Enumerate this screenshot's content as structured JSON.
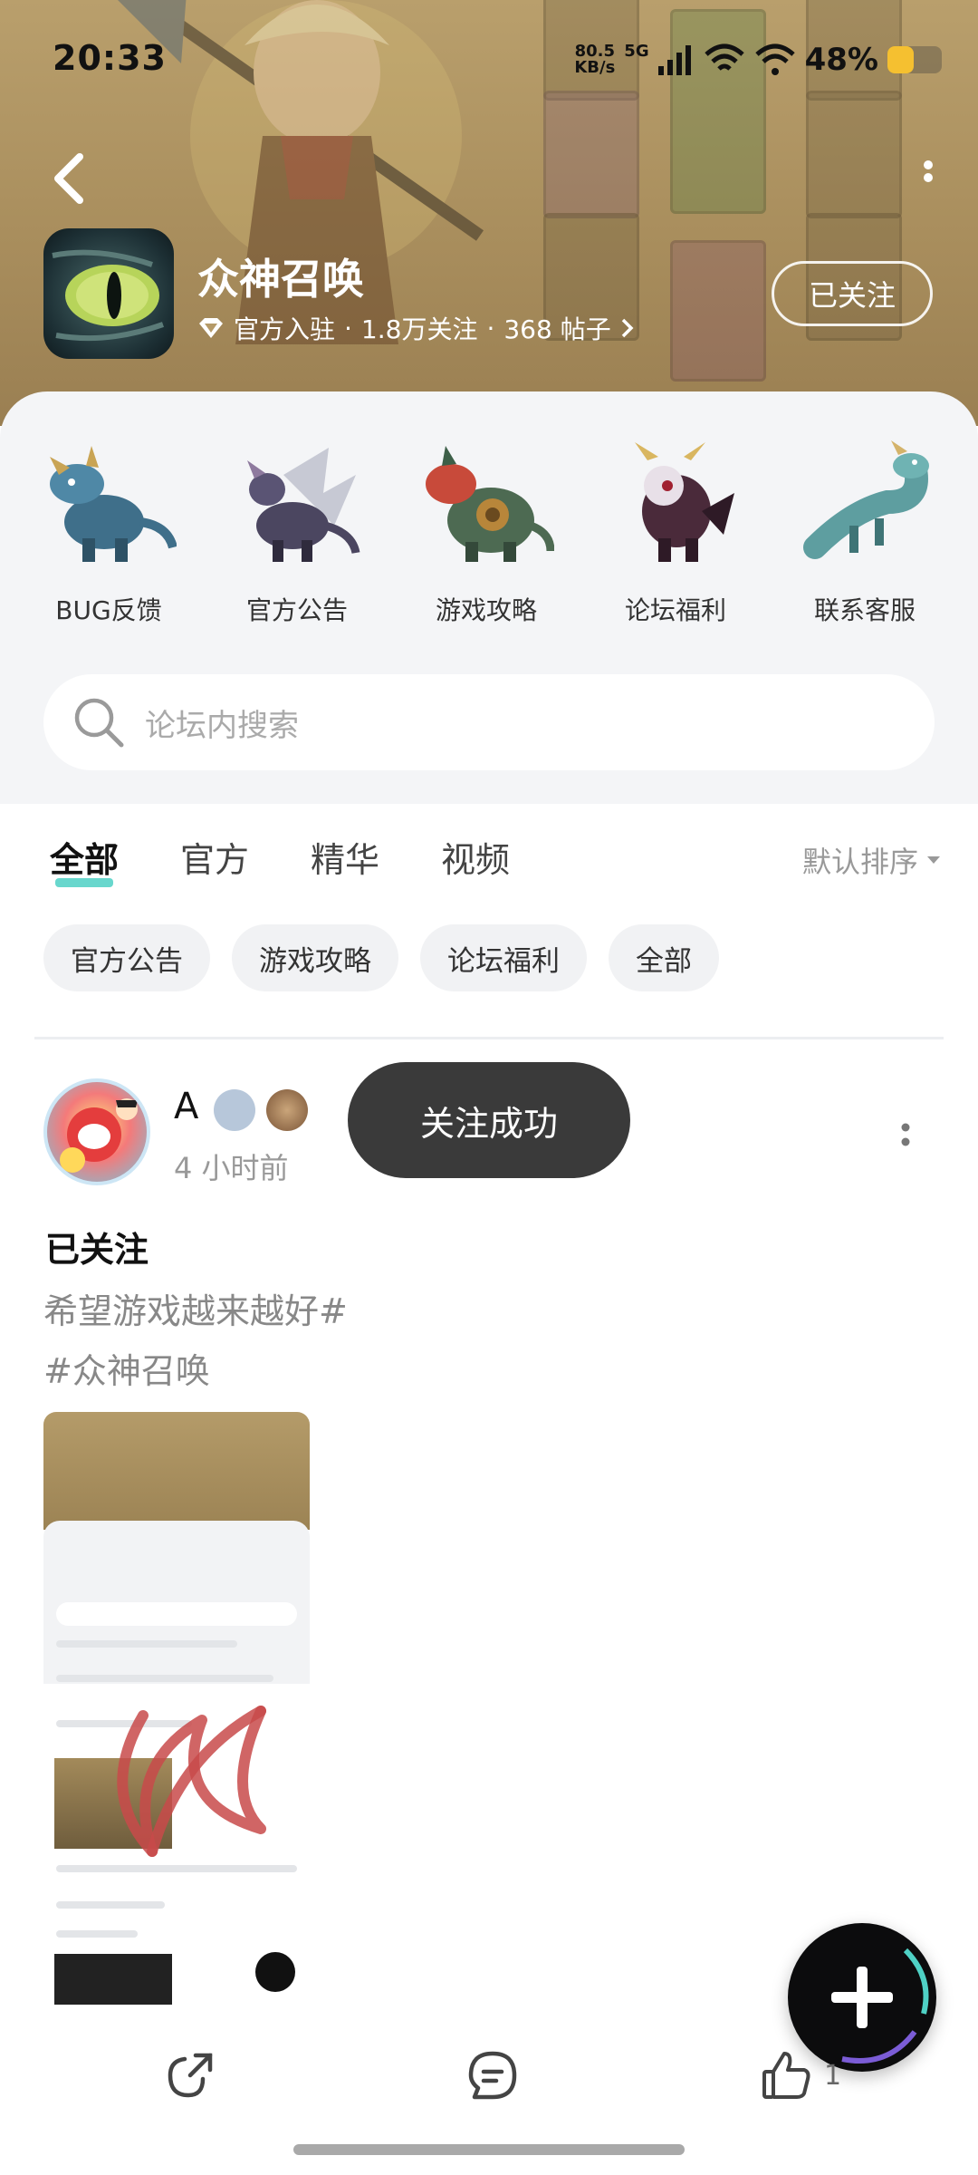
{
  "status_bar": {
    "time": "20:33",
    "net_speed_value": "80.5",
    "net_speed_unit": "KB/s",
    "network": "5G",
    "battery": "48%",
    "battery_level": 0.48
  },
  "header": {
    "title": "众神召唤",
    "meta_official": "官方入驻",
    "meta_followers": "1.8万关注",
    "meta_posts": "368 帖子",
    "separator": "·",
    "follow_label": "已关注"
  },
  "categories": [
    {
      "label": "BUG反馈",
      "icon": "blue-dragon-icon"
    },
    {
      "label": "官方公告",
      "icon": "winged-dragon-icon"
    },
    {
      "label": "游戏攻略",
      "icon": "turtle-dragon-icon"
    },
    {
      "label": "论坛福利",
      "icon": "dark-dragon-icon"
    },
    {
      "label": "联系客服",
      "icon": "teal-dragon-icon"
    }
  ],
  "search": {
    "placeholder": "论坛内搜索"
  },
  "tabs": [
    {
      "label": "全部",
      "active": true
    },
    {
      "label": "官方",
      "active": false
    },
    {
      "label": "精华",
      "active": false
    },
    {
      "label": "视频",
      "active": false
    }
  ],
  "sort_label": "默认排序",
  "chips": [
    "官方公告",
    "游戏攻略",
    "论坛福利",
    "全部"
  ],
  "post": {
    "author": "A",
    "time": "4 小时前",
    "title": "已关注",
    "body_line1": "希望游戏越来越好#",
    "body_line2": "#众神召唤"
  },
  "toast": "关注成功",
  "actions": {
    "like_count": "1"
  },
  "colors": {
    "accent": "#58d3c8",
    "toast_bg": "#3a3a3a",
    "battery": "#f5c030"
  }
}
